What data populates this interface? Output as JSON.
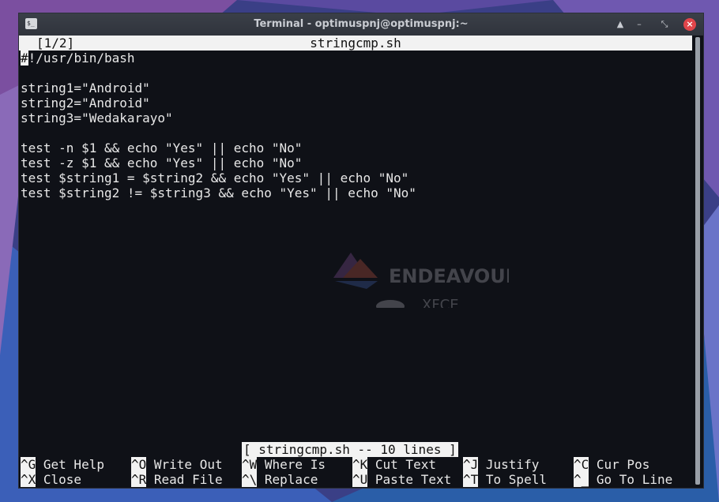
{
  "window": {
    "title": "Terminal - optimuspnj@optimuspnj:~"
  },
  "titlebar_buttons": [
    "▲",
    "–",
    "⤡",
    "×"
  ],
  "nano": {
    "buffer_index": "[1/2]",
    "filename": "stringcmp.sh",
    "lines": [
      "#!/usr/bin/bash",
      "",
      "string1=\"Android\"",
      "string2=\"Android\"",
      "string3=\"Wedakarayo\"",
      "",
      "test -n $1 && echo \"Yes\" || echo \"No\"",
      "test -z $1 && echo \"Yes\" || echo \"No\"",
      "test $string1 = $string2 && echo \"Yes\" || echo \"No\"",
      "test $string2 != $string3 && echo \"Yes\" || echo \"No\""
    ],
    "status_message": "[ stringcmp.sh -- 10 lines ]",
    "shortcuts_row1": [
      {
        "key": "^G",
        "label": "Get Help"
      },
      {
        "key": "^O",
        "label": "Write Out"
      },
      {
        "key": "^W",
        "label": "Where Is"
      },
      {
        "key": "^K",
        "label": "Cut Text"
      },
      {
        "key": "^J",
        "label": "Justify"
      },
      {
        "key": "^C",
        "label": "Cur Pos"
      }
    ],
    "shortcuts_row2": [
      {
        "key": "^X",
        "label": "Close"
      },
      {
        "key": "^R",
        "label": "Read File"
      },
      {
        "key": "^\\",
        "label": "Replace"
      },
      {
        "key": "^U",
        "label": "Paste Text"
      },
      {
        "key": "^T",
        "label": "To Spell"
      },
      {
        "key": "^_",
        "label": "Go To Line"
      }
    ]
  },
  "wallpaper_logo": {
    "brand": "ENDEAVOUROS",
    "sub": "XFCE"
  },
  "colors": {
    "terminal_bg": "#0f1117",
    "text": "#e8e8e8",
    "bar_bg": "#f2f2f2",
    "close_button": "#e0454a"
  }
}
